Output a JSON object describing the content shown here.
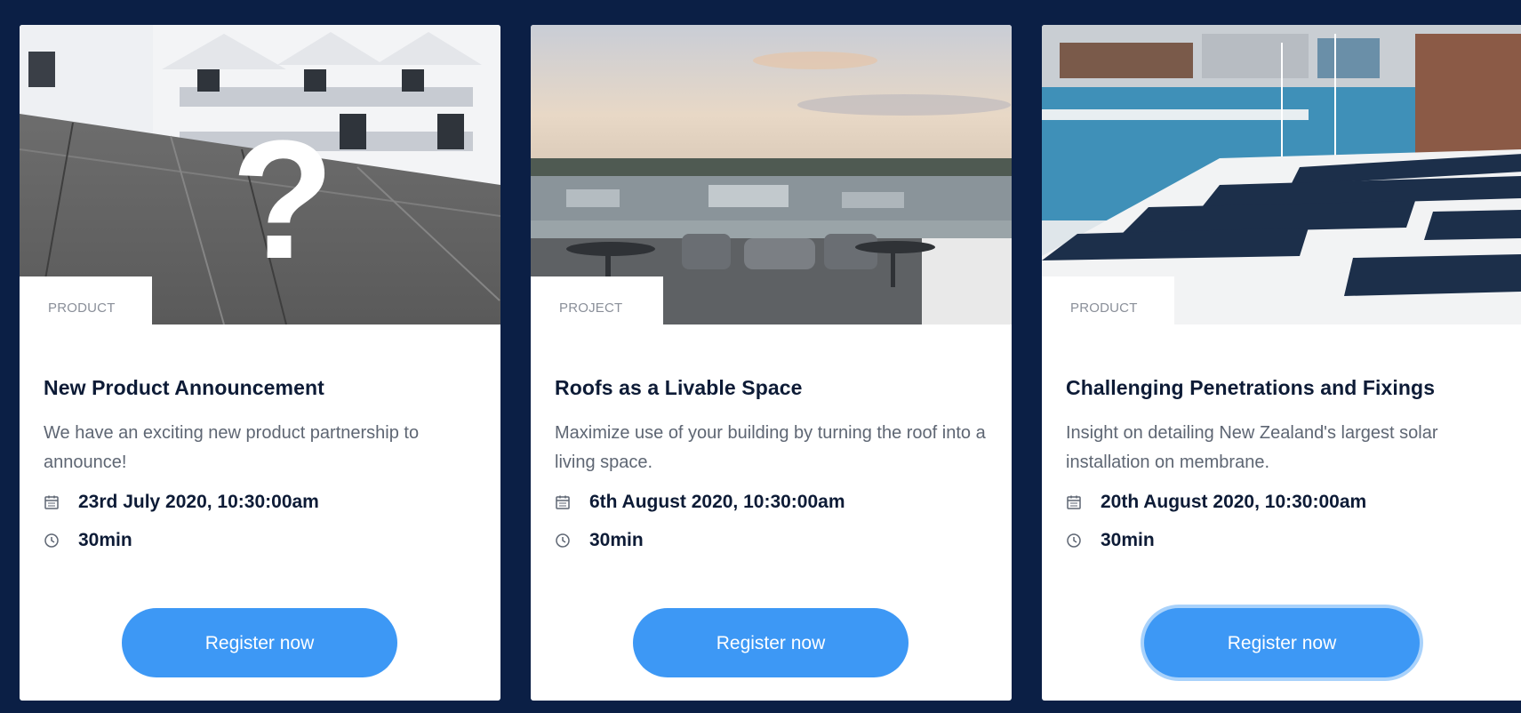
{
  "theme": {
    "background": "#0b1f45",
    "card_background": "#ffffff",
    "button_color": "#3d98f5",
    "title_color": "#0d1b36"
  },
  "cards": [
    {
      "tag": "PRODUCT",
      "title": "New Product Announcement",
      "description": "We have an exciting new product partnership to announce!",
      "date": "23rd July 2020, 10:30:00am",
      "duration": "30min",
      "button_label": "Register now",
      "image_icon": "question-mark"
    },
    {
      "tag": "PROJECT",
      "title": "Roofs as a Livable Space",
      "description": "Maximize use of your building by turning the roof into a living space.",
      "date": "6th August 2020, 10:30:00am",
      "duration": "30min",
      "button_label": "Register now",
      "image_icon": ""
    },
    {
      "tag": "PRODUCT",
      "title": "Challenging Penetrations and Fixings",
      "description": "Insight on detailing New Zealand's largest solar installation on membrane.",
      "date": "20th August 2020, 10:30:00am",
      "duration": "30min",
      "button_label": "Register now",
      "image_icon": ""
    }
  ],
  "icons": {
    "date": "calendar-icon",
    "duration": "clock-icon"
  }
}
